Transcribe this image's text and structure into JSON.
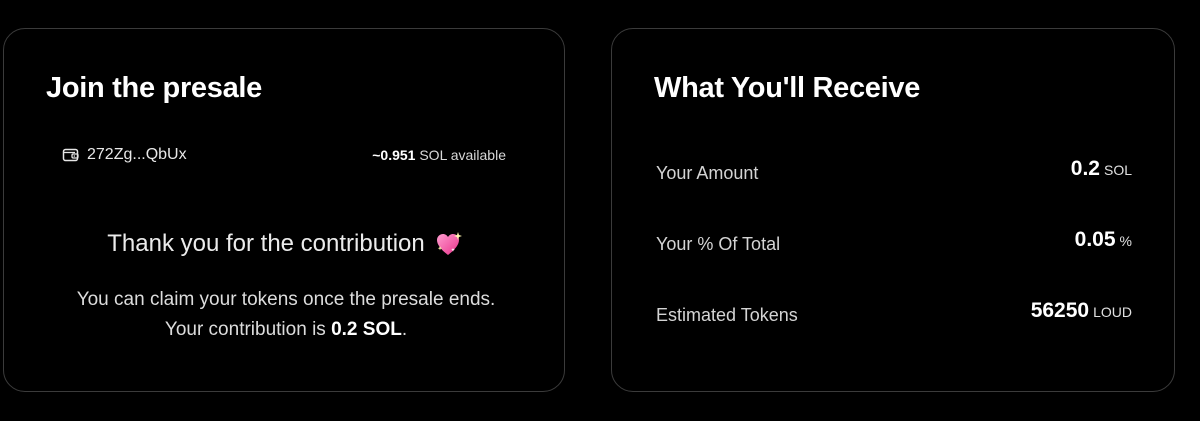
{
  "presale": {
    "title": "Join the presale",
    "wallet_address": "272Zg...QbUx",
    "balance_value": "~0.951",
    "balance_suffix": "SOL available",
    "thanks_text": "Thank you for the contribution",
    "claim_text": "You can claim your tokens once the presale ends. Your contribution is",
    "contribution_amount": "0.2 SOL",
    "claim_end": "."
  },
  "receive": {
    "title": "What You'll Receive",
    "rows": [
      {
        "label": "Your Amount",
        "value": "0.2",
        "unit": "SOL"
      },
      {
        "label": "Your % Of Total",
        "value": "0.05",
        "unit": "%"
      },
      {
        "label": "Estimated Tokens",
        "value": "56250",
        "unit": "LOUD"
      }
    ]
  },
  "colors": {
    "background": "#000000",
    "card_border": "#3b3b3b",
    "heart_pink": "#ff5fa8"
  },
  "icons": {
    "wallet": "wallet-icon",
    "heart": "sparkling-heart-icon"
  }
}
